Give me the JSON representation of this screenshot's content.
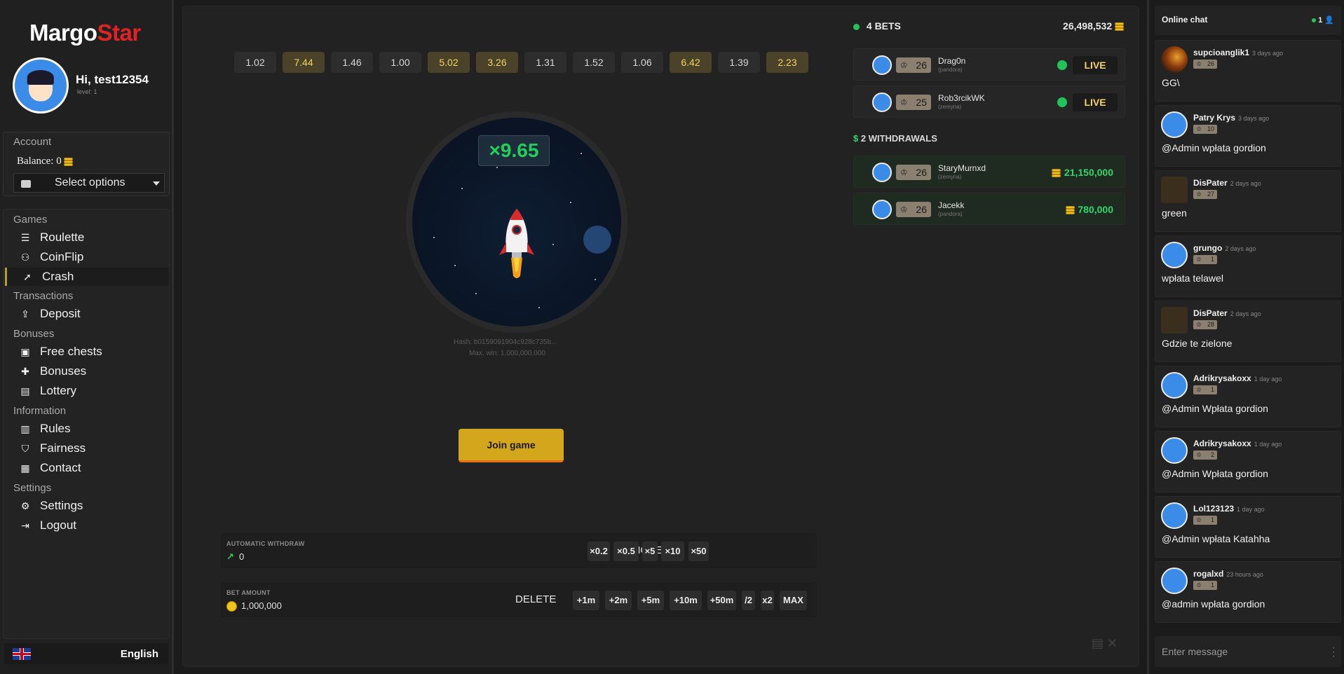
{
  "sidebar": {
    "logo_part1": "Margo",
    "logo_part2": "Star",
    "greeting": "Hi, test12354",
    "level": "level: 1",
    "account_label": "Account",
    "balance_label": "Balance: 0",
    "select_placeholder": "Select options",
    "sections": {
      "games": "Games",
      "transactions": "Transactions",
      "bonuses": "Bonuses",
      "information": "Information",
      "settings": "Settings"
    },
    "items": {
      "roulette": "Roulette",
      "coinflip": "CoinFlip",
      "crash": "Crash",
      "deposit": "Deposit",
      "free_chests": "Free chests",
      "bonuses": "Bonuses",
      "lottery": "Lottery",
      "rules": "Rules",
      "fairness": "Fairness",
      "contact": "Contact",
      "settings": "Settings",
      "logout": "Logout"
    },
    "language": "English"
  },
  "game": {
    "history": [
      "1.02",
      "7.44",
      "1.46",
      "1.00",
      "5.02",
      "3.26",
      "1.31",
      "1.52",
      "1.06",
      "6.42",
      "1.39",
      "2.23"
    ],
    "multiplier": "×9.65",
    "hash": "Hash: b0159091904c928c735b...",
    "max_win": "Max. win: 1,000,000,000",
    "join_button": "Join game",
    "auto_withdraw_label": "AUTOMATIC WITHDRAW",
    "auto_withdraw_value": "0",
    "remove_label": "REMOVE",
    "auto_chips": [
      "×0.2",
      "×0.5",
      "×5",
      "×10",
      "×50"
    ],
    "bet_amount_label": "BET AMOUNT",
    "bet_amount_value": "1,000,000",
    "delete_label": "DELETE",
    "bet_chips": [
      "+1m",
      "+2m",
      "+5m",
      "+10m",
      "+50m",
      "/2",
      "x2",
      "MAX"
    ]
  },
  "bets": {
    "title": "4 BETS",
    "total": "26,498,532",
    "live_rows": [
      {
        "level": "26",
        "name": "Drag0n",
        "sub": "(pandora)",
        "status": "LIVE"
      },
      {
        "level": "25",
        "name": "Rob3rcikWK",
        "sub": "(zemyna)",
        "status": "LIVE"
      }
    ],
    "withdrawals_title": "2 WITHDRAWALS",
    "withdraw_rows": [
      {
        "level": "26",
        "name": "StaryMurnxd",
        "sub": "(zemyna)",
        "amount": "21,150,000"
      },
      {
        "level": "26",
        "name": "Jacekk",
        "sub": "(pandora)",
        "amount": "780,000"
      }
    ]
  },
  "chat": {
    "title": "Online chat",
    "online_count": "1",
    "input_placeholder": "Enter message",
    "messages": [
      {
        "name": "supcioanglik1",
        "time": "3 days ago",
        "level": "26",
        "text": "GG\\"
      },
      {
        "name": "Patry Krys",
        "time": "3 days ago",
        "level": "10",
        "text": "@Admin wpłata gordion"
      },
      {
        "name": "DisPater",
        "time": "2 days ago",
        "level": "27",
        "text": "green"
      },
      {
        "name": "grungo",
        "time": "2 days ago",
        "level": "1",
        "text": "wpłata telawel"
      },
      {
        "name": "DisPater",
        "time": "2 days ago",
        "level": "28",
        "text": "Gdzie te zielone"
      },
      {
        "name": "Adrikrysakoxx",
        "time": "1 day ago",
        "level": "1",
        "text": "@Admin Wpłata gordion"
      },
      {
        "name": "Adrikrysakoxx",
        "time": "1 day ago",
        "level": "2",
        "text": "@Admin Wpłata gordion"
      },
      {
        "name": "Lol123123",
        "time": "1 day ago",
        "level": "1",
        "text": "@Admin wpłata Katahha"
      },
      {
        "name": "rogalxd",
        "time": "23 hours ago",
        "level": "1",
        "text": "@admin wpłata gordion"
      }
    ]
  },
  "colors": {
    "accent_gold": "#d4a61c",
    "live_green": "#21c45a",
    "brand_red": "#e02424"
  }
}
